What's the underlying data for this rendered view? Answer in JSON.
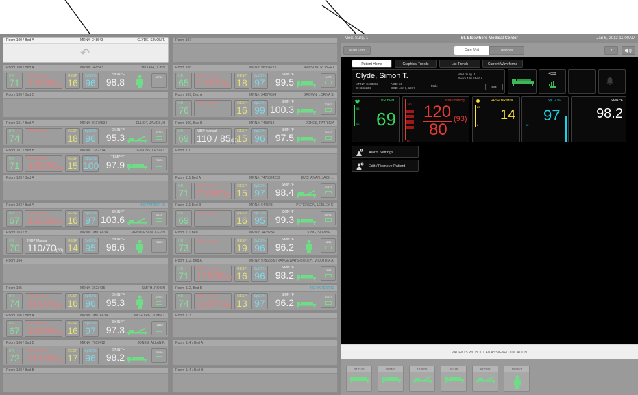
{
  "left_grid": {
    "col1": [
      {
        "type": "selected",
        "room": "Room 100 / Bed A",
        "mrn": "MRN#: 348543",
        "name": "CLYDE, SIMON T."
      },
      {
        "type": "patient",
        "room": "Room 100 / Bed A",
        "mrn": "MRN#: 348543",
        "name": "MILLER, JOHN",
        "hr": "71",
        "nibp": "120/80",
        "nibp_map": "(93)",
        "resp": "16",
        "spo2": "96",
        "temp_label": "SKIN °F",
        "temp": "98.8",
        "icon": "person",
        "tele": "40762"
      },
      {
        "type": "empty",
        "room": "Room 100 / Bed C"
      },
      {
        "type": "patient",
        "room": "Room 101 / Bed A",
        "mrn": "MRN#: 91976534",
        "name": "ELLIOT, JAMES, H",
        "hr": "74",
        "nibp": "",
        "nibp_map": "",
        "resp": "18",
        "spo2": "96",
        "temp_label": "SKIN °F",
        "temp": "95.3",
        "icon": "bed-incline",
        "tele": "40762"
      },
      {
        "type": "patient",
        "room": "Room 101 / Bed B",
        "mrn": "MRN#: 7382314",
        "name": "JENKINS, LESLEY",
        "hr": "71",
        "nibp": "125/80",
        "nibp_map": "(95)",
        "resp": "15",
        "spo2": "100",
        "temp_label": "TEMP °F",
        "temp": "97.9",
        "icon": "bed",
        "tele": "70076"
      },
      {
        "type": "empty",
        "room": "Room 103 / Bed A"
      },
      {
        "type": "patient",
        "room": "Room 103 / Bed A",
        "mrn": "",
        "name": "NO PATIENT ID",
        "noid": true,
        "hr": "67",
        "nibp": "125/80",
        "nibp_map": "(95)",
        "resp": "16",
        "spo2": "97",
        "temp_label": "SKIN °F",
        "temp": "103.6",
        "icon": "bed-incline",
        "tele": "5873"
      },
      {
        "type": "patient",
        "room": "Room 103 / B",
        "mrn": "MRN#: 3H074634",
        "name": "MENDLESON, KEVIN",
        "hr": "70",
        "nibp": "110/70",
        "nibp_map": "(83)",
        "nibp_white": true,
        "resp": "14",
        "spo2": "95",
        "temp_label": "SKIN °F",
        "temp": "96.6",
        "icon": "person",
        "tele": "72853"
      },
      {
        "type": "empty",
        "room": "Room 104"
      },
      {
        "type": "patient",
        "room": "Room 105",
        "mrn": "MRN#: 3623435",
        "name": "SMITH, ROBIN",
        "hr": "74",
        "nibp": "110/70",
        "nibp_map": "(83)",
        "resp": "16",
        "spo2": "96",
        "temp_label": "SKIN °F",
        "temp": "95.3",
        "icon": "person",
        "tele": "40762"
      },
      {
        "type": "patient",
        "room": "Room 106 / Bed A",
        "mrn": "MRN#: 3H074634",
        "name": "MCGUIRE, JOHN J.",
        "hr": "67",
        "nibp": "120/80",
        "nibp_map": "(93)",
        "resp": "16",
        "spo2": "97",
        "temp_label": "SKIN °F",
        "temp": "97.3",
        "icon": "bed-incline",
        "tele": "72853"
      },
      {
        "type": "patient",
        "room": "Room 106 / Bed B",
        "mrn": "MRN#: 7659412",
        "name": "JONES, ALLAN P.",
        "hr": "72",
        "nibp": "110/90",
        "nibp_map": "(87)",
        "resp": "17",
        "spo2": "96",
        "temp_label": "SKIN °F",
        "temp": "98.2",
        "icon": "bed",
        "tele": "76049"
      },
      {
        "type": "empty",
        "room": "Room 108 / Bed B"
      }
    ],
    "col2": [
      {
        "type": "empty",
        "room": "Room 107"
      },
      {
        "type": "patient",
        "room": "Room 108",
        "mrn": "MRN#: 98364223",
        "name": "JAMISON, ROBERT",
        "hr": "65",
        "nibp": "110/70",
        "nibp_map": "(83)",
        "resp": "18",
        "spo2": "97",
        "temp_label": "SKIN °F",
        "temp": "99.5",
        "icon": "bed",
        "tele": "5473"
      },
      {
        "type": "patient",
        "room": "Room 109, Bed A",
        "mrn": "MRN#: 34274534",
        "name": "BROWN, LORNA S.",
        "hr": "76",
        "nibp": "",
        "nibp_map": "",
        "resp": "16",
        "spo2": "99",
        "temp_label": "SKIN °F",
        "temp": "100.3",
        "icon": "bed",
        "tele": "72853"
      },
      {
        "type": "patient",
        "room": "Room 109, Bed B",
        "mrn": "MRN#: 7458412",
        "name": "JONES, PATRICIA",
        "hr": "69",
        "nibp": "110 / 85",
        "nibp_map": "(93)",
        "nibp_white": true,
        "resp": "15",
        "spo2": "96",
        "temp_label": "SKIN °F",
        "temp": "97.5",
        "icon": "bed",
        "tele": "76049"
      },
      {
        "type": "empty",
        "room": "Room 110"
      },
      {
        "type": "patient",
        "room": "Room 111 Bed A",
        "mrn": "MRN#: 7475824232",
        "name": "BUCHANAN, JACK L.",
        "hr": "71",
        "nibp": "110/80",
        "nibp_map": "(83)",
        "resp": "15",
        "spo2": "97",
        "temp_label": "SKIN °F",
        "temp": "98.4",
        "icon": "bed-incline",
        "tele": "42323"
      },
      {
        "type": "patient",
        "room": "Room 111 Bed B",
        "mrn": "MRN#: 644543",
        "name": "PETERSON, LESLEY G.",
        "hr": "69",
        "nibp": "",
        "nibp_map": "",
        "resp": "16",
        "spo2": "95",
        "temp_label": "SKIN °F",
        "temp": "99.3",
        "icon": "bed",
        "tele": "45780"
      },
      {
        "type": "patient",
        "room": "Room 111 Bed C",
        "mrn": "MRN#: 3478234",
        "name": "KING, SOPHIE L.",
        "hr": "73",
        "nibp": "",
        "nibp_map": "",
        "resp": "19",
        "spo2": "96",
        "temp_label": "SKIN °F",
        "temp": "96.2",
        "icon": "person",
        "tele": "4231"
      },
      {
        "type": "patient",
        "room": "Room 112, Bed A",
        "mrn": "MRN#: 9786587",
        "name": "STRANGEWAYS-BOOTH, VICOTRIA A.",
        "hr": "71",
        "nibp": "125/80",
        "nibp_map": "(95)",
        "resp": "16",
        "spo2": "96",
        "temp_label": "SKIN °F",
        "temp": "98.2",
        "icon": "bed",
        "tele": "7832"
      },
      {
        "type": "patient",
        "room": "Room 112, Bed B",
        "mrn": "",
        "name": "NO PATIENT ID",
        "noid": true,
        "hr": "74",
        "nibp": "110/70",
        "nibp_map": "(83)",
        "resp": "13",
        "spo2": "97",
        "temp_label": "SKIN °F",
        "temp": "96.2",
        "icon": "bed",
        "tele": "42323"
      },
      {
        "type": "empty",
        "room": "Room 113"
      },
      {
        "type": "empty",
        "room": "Room 114 / Bed A"
      },
      {
        "type": "empty",
        "room": "Room 114 / Bed B"
      }
    ],
    "vital_labels": {
      "hr": "HR",
      "nibp": "NIBP",
      "nibp_mode": "Manual",
      "resp": "RESP",
      "spo2": "SpO2%"
    }
  },
  "right": {
    "unit": "Med. Surg. 1",
    "hospital": "St. Elsewhere Medical Center",
    "date": "Jan 6, 2012 11:00AM",
    "main_btn": "Main Grid",
    "seg_careunit": "Care Unit",
    "seg_devices": "Devices",
    "help": "?",
    "tabs": [
      "Patient Home",
      "Graphical Trends",
      "List Trends",
      "Current Waveforms"
    ],
    "patient": {
      "name": "Clyde, Simon T.",
      "mrn": "MRN#: 3493892",
      "id": "ID: 343234",
      "age": "AGE: 36",
      "dob": "DOB: Jan 6, 1977",
      "sex": "Male",
      "unit": "Med. Surg. 1",
      "room": "Room 100 / Bed A",
      "edit": "Edit"
    },
    "tele_id": "4333",
    "vitals": {
      "hr": {
        "label": "HR BPM",
        "value": "69",
        "hi": "55",
        "lo": "55"
      },
      "nibp": {
        "label": "NIBP mmHg",
        "sys": "120",
        "dia": "80",
        "map": "(93)",
        "scale_hi": "180",
        "scale_lo": "60"
      },
      "resp": {
        "label": "RESP BR/MIN",
        "value": "14",
        "hi": "20",
        "lo": "8"
      },
      "spo2": {
        "label": "SpO2 %",
        "value": "97",
        "lo": "92"
      },
      "skin": {
        "label": "SKIN °F",
        "value": "98.2"
      }
    },
    "actions": [
      "Alarm Settings",
      "Edit / Remove Patient"
    ],
    "unassigned_title": "PATIENTS WITHOUT AN ASSIGNED LOCATION",
    "unassigned": [
      {
        "id": "343240",
        "icon": "bed"
      },
      {
        "id": "763402",
        "icon": "bed"
      },
      {
        "id": "124535",
        "icon": "bed-incline"
      },
      {
        "id": "65345",
        "icon": "bed"
      },
      {
        "id": "987342",
        "icon": "bed-incline"
      },
      {
        "id": "194352",
        "icon": "person"
      }
    ]
  },
  "colors": {
    "hr": "#34d65c",
    "nibp": "#e53935",
    "resp": "#ffe23a",
    "spo2": "#1ad1e6",
    "alarm": "#e21d1d"
  }
}
